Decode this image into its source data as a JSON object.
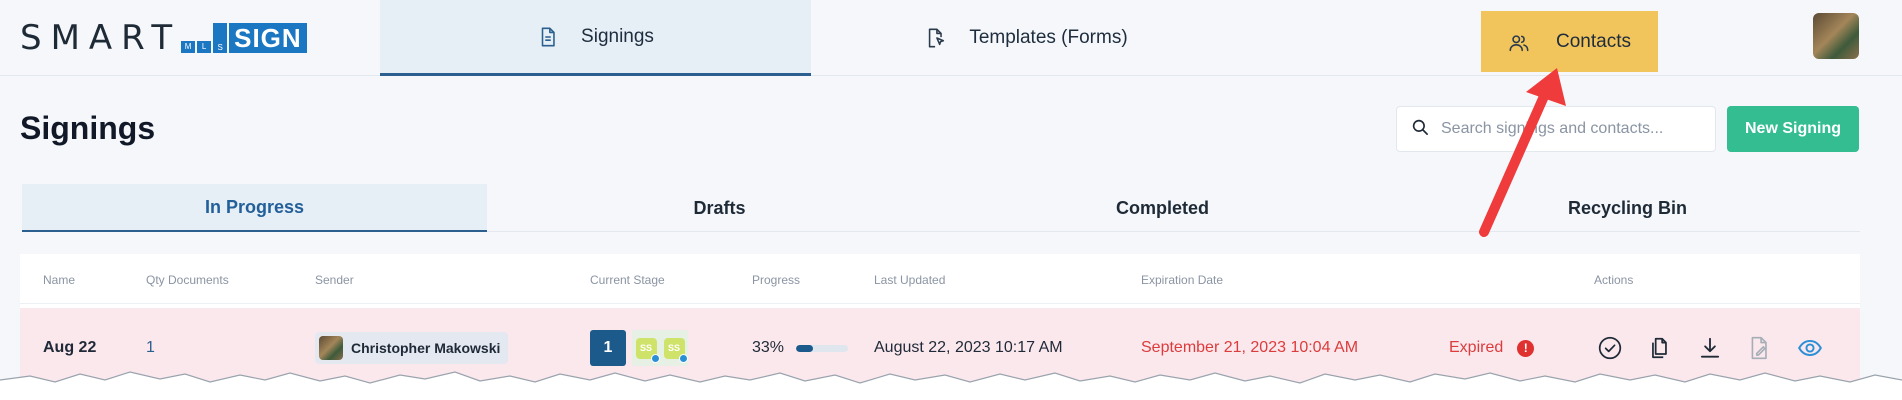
{
  "logo": {
    "smart": "SMART",
    "mls": [
      "M",
      "L",
      "S"
    ],
    "sign": "SIGN"
  },
  "nav": {
    "signings": {
      "label": "Signings",
      "icon": "document-icon"
    },
    "templates": {
      "label": "Templates (Forms)",
      "icon": "document-cursor-icon"
    },
    "contacts": {
      "label": "Contacts",
      "icon": "users-icon"
    }
  },
  "page": {
    "title": "Signings"
  },
  "search": {
    "placeholder": "Search signings and contacts...",
    "value": ""
  },
  "new_signing": {
    "label": "New Signing"
  },
  "subtabs": [
    "In Progress",
    "Drafts",
    "Completed",
    "Recycling Bin"
  ],
  "table": {
    "headers": [
      "Name",
      "Qty Documents",
      "Sender",
      "Current Stage",
      "Progress",
      "Last Updated",
      "Expiration Date",
      "Actions"
    ],
    "rows": [
      {
        "name": "Aug 22",
        "qty": "1",
        "sender": "Christopher Makowski",
        "stage": "1",
        "stage_badges": [
          "SS",
          "SS"
        ],
        "progress_text": "33%",
        "progress_value": 0.33,
        "last_updated": "August 22, 2023 10:17 AM",
        "expiration": "September 21, 2023 10:04 AM",
        "status": "Expired",
        "actions": [
          "check-circle-icon",
          "copy-icon",
          "download-icon",
          "edit-document-icon",
          "eye-icon"
        ]
      }
    ]
  },
  "colors": {
    "accent": "#1c77c3",
    "contacts_highlight": "#f2c45c",
    "new_button": "#33bd91",
    "row_bg": "#fbe8ed",
    "expired": "#dc3c3c",
    "annotation_arrow": "#ef3b3b"
  }
}
